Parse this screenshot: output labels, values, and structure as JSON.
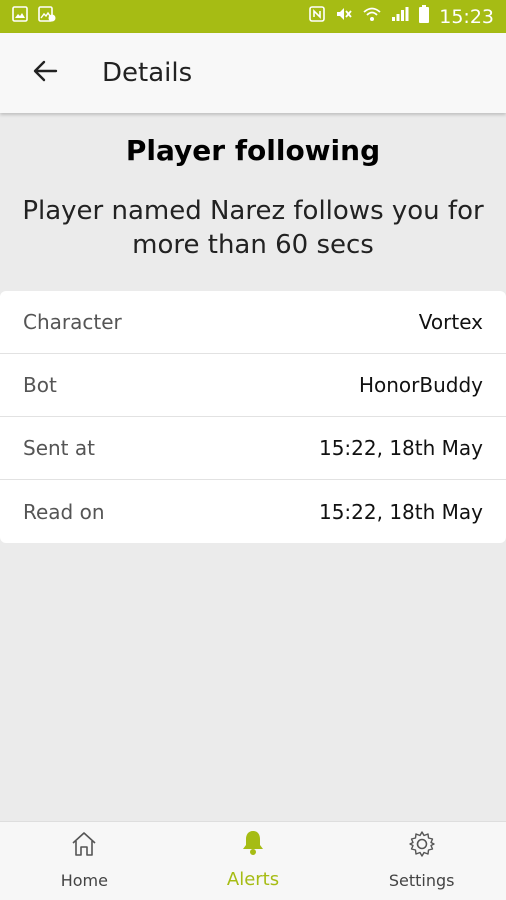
{
  "status": {
    "time": "15:23",
    "bar_color": "#a6bc14",
    "left_icons": [
      "image-icon",
      "gallery-badge-icon"
    ],
    "right_icons": [
      "nfc-icon",
      "mute-icon",
      "wifi-icon",
      "signal-icon",
      "battery-icon"
    ]
  },
  "appbar": {
    "title": "Details",
    "back_icon": "arrow-left-icon"
  },
  "alert": {
    "title": "Player following",
    "message": "Player named Narez follows you for more than 60 secs"
  },
  "details": [
    {
      "label": "Character",
      "value": "Vortex"
    },
    {
      "label": "Bot",
      "value": "HonorBuddy"
    },
    {
      "label": "Sent at",
      "value": "15:22, 18th May"
    },
    {
      "label": "Read on",
      "value": "15:22, 18th May"
    }
  ],
  "nav": {
    "accent": "#a6bc14",
    "items": [
      {
        "label": "Home",
        "icon": "home-icon",
        "active": false
      },
      {
        "label": "Alerts",
        "icon": "bell-icon",
        "active": true
      },
      {
        "label": "Settings",
        "icon": "gear-icon",
        "active": false
      }
    ]
  }
}
